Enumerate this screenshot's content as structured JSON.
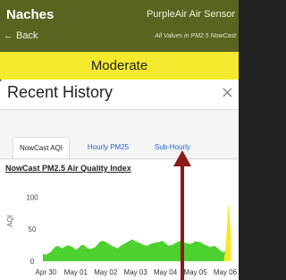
{
  "header": {
    "title": "Naches",
    "sensor_name": "PurpleAir Air Sensor",
    "back_label": "← Back",
    "values_note": "All Values in PM2.5 NowCast"
  },
  "aqi_banner": {
    "label": "Moderate",
    "color": "#f5e92e"
  },
  "panel": {
    "title": "Recent History",
    "close_glyph": "×"
  },
  "tabs": [
    {
      "label": "NowCast AQI",
      "active": true
    },
    {
      "label": "Hourly PM25",
      "active": false
    },
    {
      "label": "Sub-Hourly",
      "active": false
    }
  ],
  "chart_data": {
    "type": "area",
    "title": "NowCast PM2.5 Air Quality Index",
    "ylabel": "AQI",
    "ylim": [
      0,
      120
    ],
    "yticks": [
      0,
      50,
      100
    ],
    "x_tick_labels": [
      "Apr 30",
      "May 01",
      "May 02",
      "May 03",
      "May 04",
      "May 05",
      "May 06"
    ],
    "series": [
      {
        "color": "#4cd12e",
        "x": [
          0,
          0.1,
          0.25,
          0.4,
          0.5,
          0.65,
          0.75,
          0.85,
          1.0,
          1.1,
          1.2,
          1.3,
          1.4,
          1.5,
          1.6,
          1.75,
          1.9,
          2.0,
          2.1,
          2.2,
          2.35,
          2.5,
          2.6,
          2.75,
          2.9,
          3.0,
          3.1,
          3.25,
          3.4,
          3.5,
          3.6,
          3.75,
          3.9,
          4.0,
          4.1,
          4.2,
          4.35,
          4.5,
          4.6,
          4.75,
          4.9,
          5.0,
          5.1,
          5.25,
          5.4,
          5.5,
          5.6,
          5.75,
          5.85,
          5.95,
          6.05,
          6.15
        ],
        "values": [
          12,
          10,
          14,
          22,
          24,
          20,
          23,
          25,
          22,
          18,
          21,
          26,
          24,
          20,
          19,
          22,
          30,
          32,
          30,
          27,
          23,
          20,
          24,
          28,
          32,
          34,
          31,
          28,
          25,
          24,
          27,
          29,
          30,
          32,
          28,
          24,
          26,
          30,
          32,
          29,
          27,
          28,
          31,
          30,
          26,
          24,
          22,
          24,
          20,
          16,
          14,
          18
        ]
      },
      {
        "color": "#f5e92e",
        "x": [
          6.05,
          6.1,
          6.15,
          6.2,
          6.25,
          6.3
        ],
        "values": [
          0,
          15,
          45,
          90,
          70,
          40
        ]
      }
    ]
  }
}
